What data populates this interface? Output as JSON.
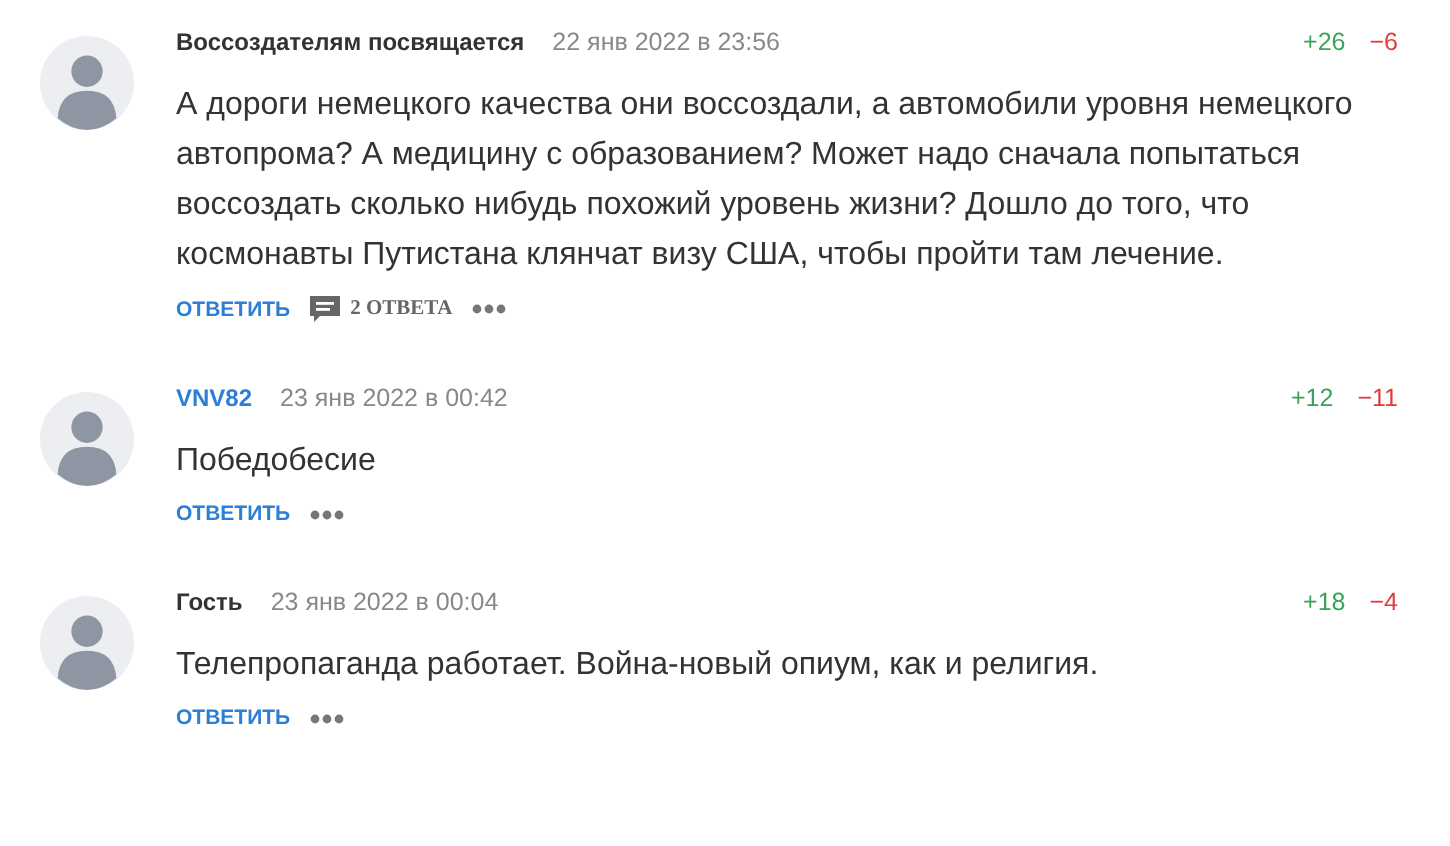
{
  "comments": [
    {
      "author": "Воссоздателям посвящается",
      "kind": "guest",
      "date": "22 янв 2022 в 23:56",
      "up": "+26",
      "down": "−6",
      "text": "А дороги немецкого качества они воссоздали, а автомобили уровня немецкого автопрома? А медицину с образованием? Может надо сначала попытаться воссоздать сколько нибудь похожий уровень жизни? Дошло до того, что космонавты Путистана клянчат визу США, чтобы пройти там лечение.",
      "reply": "ОТВЕТИТЬ",
      "replies": "2 ОТВЕТА"
    },
    {
      "author": "VNV82",
      "kind": "user",
      "date": "23 янв 2022 в 00:42",
      "up": "+12",
      "down": "−11",
      "text": "Победобесие",
      "reply": "ОТВЕТИТЬ"
    },
    {
      "author": "Гость",
      "kind": "guest",
      "date": "23 янв 2022 в 00:04",
      "up": "+18",
      "down": "−4",
      "text": "Телепропаганда работает. Война-новый опиум, как и религия.",
      "reply": "ОТВЕТИТЬ"
    }
  ]
}
